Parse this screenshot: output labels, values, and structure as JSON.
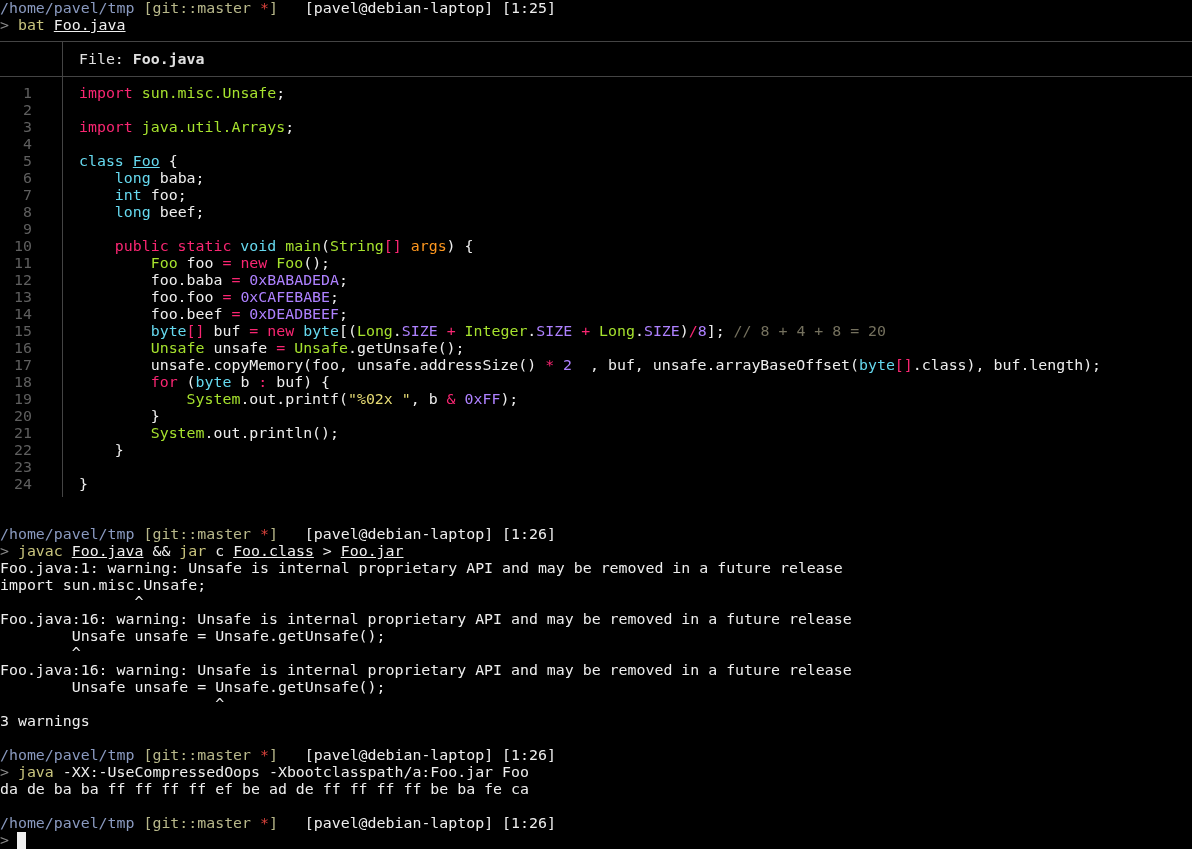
{
  "blocks": [
    {
      "kind": "lines",
      "lines": [
        {
          "kind": "text",
          "tokens": [
            {
              "text": "/home/pavel/tmp",
              "kind": "path"
            },
            {
              "text": " [git::master ",
              "kind": "git"
            },
            {
              "text": "*",
              "kind": "dirty"
            },
            {
              "text": "]",
              "kind": "git"
            },
            {
              "text": "   [pavel@debian-laptop] [1:25]",
              "kind": "plain"
            }
          ]
        },
        {
          "kind": "text",
          "tokens": [
            {
              "text": ">",
              "kind": "prompt"
            },
            {
              "text": " bat ",
              "kind": "command"
            },
            {
              "text": "Foo.java",
              "kind": "file"
            }
          ]
        }
      ]
    },
    {
      "kind": "bat",
      "header": "File: **Foo.java**",
      "lines": [
        {
          "number": "1",
          "tokens": [
            {
              "text": "import",
              "kind": "keyword"
            },
            {
              "text": " sun.misc.Unsafe",
              "kind": "class"
            },
            {
              "text": ";",
              "kind": "plain"
            }
          ]
        },
        {
          "number": "2"
        },
        {
          "number": "3",
          "tokens": [
            {
              "text": "import",
              "kind": "keyword"
            },
            {
              "text": " java.util.Arrays",
              "kind": "class"
            },
            {
              "text": ";",
              "kind": "plain"
            }
          ]
        },
        {
          "number": "4"
        },
        {
          "number": "5",
          "tokens": [
            {
              "text": "class ",
              "kind": "type"
            },
            {
              "text": "Foo",
              "kind": "decl"
            },
            {
              "text": " {",
              "kind": "plain"
            }
          ]
        },
        {
          "number": "6",
          "tokens": [
            {
              "text": "    long",
              "kind": "type"
            },
            {
              "text": " baba;",
              "kind": "plain"
            }
          ]
        },
        {
          "number": "7",
          "tokens": [
            {
              "text": "    int",
              "kind": "type"
            },
            {
              "text": " foo;",
              "kind": "plain"
            }
          ]
        },
        {
          "number": "8",
          "tokens": [
            {
              "text": "    long",
              "kind": "type"
            },
            {
              "text": " beef;",
              "kind": "plain"
            }
          ]
        },
        {
          "number": "9"
        },
        {
          "number": "10",
          "tokens": [
            {
              "text": "    public static",
              "kind": "keyword"
            },
            {
              "text": " void",
              "kind": "type"
            },
            {
              "text": " main",
              "kind": "class"
            },
            {
              "text": "(",
              "kind": "plain"
            },
            {
              "text": "String",
              "kind": "class"
            },
            {
              "text": "[]",
              "kind": "operator"
            },
            {
              "text": " args",
              "kind": "param"
            },
            {
              "text": ") {",
              "kind": "plain"
            }
          ]
        },
        {
          "number": "11",
          "tokens": [
            {
              "text": "        Foo",
              "kind": "class"
            },
            {
              "text": " foo ",
              "kind": "plain"
            },
            {
              "text": "=",
              "kind": "operator"
            },
            {
              "text": " new",
              "kind": "keyword"
            },
            {
              "text": " Foo",
              "kind": "class"
            },
            {
              "text": "();",
              "kind": "plain"
            }
          ]
        },
        {
          "number": "12",
          "tokens": [
            {
              "text": "        foo.baba ",
              "kind": "plain"
            },
            {
              "text": "=",
              "kind": "operator"
            },
            {
              "text": " 0xBABADEDA",
              "kind": "number"
            },
            {
              "text": ";",
              "kind": "plain"
            }
          ]
        },
        {
          "number": "13",
          "tokens": [
            {
              "text": "        foo.foo ",
              "kind": "plain"
            },
            {
              "text": "=",
              "kind": "operator"
            },
            {
              "text": " 0xCAFEBABE",
              "kind": "number"
            },
            {
              "text": ";",
              "kind": "plain"
            }
          ]
        },
        {
          "number": "14",
          "tokens": [
            {
              "text": "        foo.beef ",
              "kind": "plain"
            },
            {
              "text": "=",
              "kind": "operator"
            },
            {
              "text": " 0xDEADBEEF",
              "kind": "number"
            },
            {
              "text": ";",
              "kind": "plain"
            }
          ]
        },
        {
          "number": "15",
          "tokens": [
            {
              "text": "        byte",
              "kind": "type"
            },
            {
              "text": "[]",
              "kind": "operator"
            },
            {
              "text": " buf ",
              "kind": "plain"
            },
            {
              "text": "=",
              "kind": "operator"
            },
            {
              "text": " new",
              "kind": "keyword"
            },
            {
              "text": " byte",
              "kind": "type"
            },
            {
              "text": "[(",
              "kind": "plain"
            },
            {
              "text": "Long",
              "kind": "class"
            },
            {
              "text": ".",
              "kind": "plain"
            },
            {
              "text": "SIZE",
              "kind": "number"
            },
            {
              "text": " +",
              "kind": "operator"
            },
            {
              "text": " Integer",
              "kind": "class"
            },
            {
              "text": ".",
              "kind": "plain"
            },
            {
              "text": "SIZE",
              "kind": "number"
            },
            {
              "text": " +",
              "kind": "operator"
            },
            {
              "text": " Long",
              "kind": "class"
            },
            {
              "text": ".",
              "kind": "plain"
            },
            {
              "text": "SIZE",
              "kind": "number"
            },
            {
              "text": ")",
              "kind": "plain"
            },
            {
              "text": "/",
              "kind": "operator"
            },
            {
              "text": "8",
              "kind": "number"
            },
            {
              "text": "];",
              "kind": "plain"
            },
            {
              "text": " // 8 + 4 + 8 = 20",
              "kind": "comment"
            }
          ]
        },
        {
          "number": "16",
          "tokens": [
            {
              "text": "        Unsafe",
              "kind": "class"
            },
            {
              "text": " unsafe ",
              "kind": "plain"
            },
            {
              "text": "=",
              "kind": "operator"
            },
            {
              "text": " Unsafe",
              "kind": "class"
            },
            {
              "text": ".getUnsafe();",
              "kind": "plain"
            }
          ]
        },
        {
          "number": "17",
          "tokens": [
            {
              "text": "        unsafe.copyMemory(foo, unsafe.addressSize() ",
              "kind": "plain"
            },
            {
              "text": "*",
              "kind": "operator"
            },
            {
              "text": " 2",
              "kind": "number"
            },
            {
              "text": "  , buf, unsafe.arrayBaseOffset(",
              "kind": "plain"
            },
            {
              "text": "byte",
              "kind": "type"
            },
            {
              "text": "[]",
              "kind": "operator"
            },
            {
              "text": ".class), buf.length);",
              "kind": "plain"
            }
          ]
        },
        {
          "number": "18",
          "tokens": [
            {
              "text": "        for",
              "kind": "keyword"
            },
            {
              "text": " (",
              "kind": "plain"
            },
            {
              "text": "byte",
              "kind": "type"
            },
            {
              "text": " b ",
              "kind": "plain"
            },
            {
              "text": ":",
              "kind": "operator"
            },
            {
              "text": " buf) {",
              "kind": "plain"
            }
          ]
        },
        {
          "number": "19",
          "tokens": [
            {
              "text": "            System",
              "kind": "class"
            },
            {
              "text": ".out.printf(",
              "kind": "plain"
            },
            {
              "text": "\"%02x \"",
              "kind": "string"
            },
            {
              "text": ", b ",
              "kind": "plain"
            },
            {
              "text": "&",
              "kind": "operator"
            },
            {
              "text": " 0xFF",
              "kind": "number"
            },
            {
              "text": ");",
              "kind": "plain"
            }
          ]
        },
        {
          "number": "20",
          "tokens": [
            {
              "text": "        }",
              "kind": "plain"
            }
          ]
        },
        {
          "number": "21",
          "tokens": [
            {
              "text": "        System",
              "kind": "class"
            },
            {
              "text": ".out.println();",
              "kind": "plain"
            }
          ]
        },
        {
          "number": "22",
          "tokens": [
            {
              "text": "    }",
              "kind": "plain"
            }
          ]
        },
        {
          "number": "23"
        },
        {
          "number": "24",
          "tokens": [
            {
              "text": "}",
              "kind": "plain"
            }
          ]
        }
      ]
    },
    {
      "kind": "lines",
      "lines": [
        {
          "kind": "blank"
        },
        {
          "kind": "text",
          "tokens": [
            {
              "text": "/home/pavel/tmp",
              "kind": "path"
            },
            {
              "text": " [git::master ",
              "kind": "git"
            },
            {
              "text": "*",
              "kind": "dirty"
            },
            {
              "text": "]",
              "kind": "git"
            },
            {
              "text": "   [pavel@debian-laptop] [1:26]",
              "kind": "plain"
            }
          ]
        },
        {
          "kind": "text",
          "tokens": [
            {
              "text": ">",
              "kind": "prompt"
            },
            {
              "text": " javac ",
              "kind": "command"
            },
            {
              "text": "Foo.java",
              "kind": "file"
            },
            {
              "text": " && ",
              "kind": "plain"
            },
            {
              "text": "jar",
              "kind": "command"
            },
            {
              "text": " c ",
              "kind": "plain"
            },
            {
              "text": "Foo.class",
              "kind": "file"
            },
            {
              "text": " > ",
              "kind": "plain"
            },
            {
              "text": "Foo.jar",
              "kind": "file"
            }
          ]
        },
        {
          "kind": "text",
          "tokens": [
            {
              "text": "Foo.java:1: warning: Unsafe is internal proprietary API and may be removed in a future release",
              "kind": "plain"
            }
          ]
        },
        {
          "kind": "text",
          "tokens": [
            {
              "text": "import sun.misc.Unsafe;",
              "kind": "plain"
            }
          ]
        },
        {
          "kind": "text",
          "tokens": [
            {
              "text": "               ^",
              "kind": "plain"
            }
          ]
        },
        {
          "kind": "text",
          "tokens": [
            {
              "text": "Foo.java:16: warning: Unsafe is internal proprietary API and may be removed in a future release",
              "kind": "plain"
            }
          ]
        },
        {
          "kind": "text",
          "tokens": [
            {
              "text": "        Unsafe unsafe = Unsafe.getUnsafe();",
              "kind": "plain"
            }
          ]
        },
        {
          "kind": "text",
          "tokens": [
            {
              "text": "        ^",
              "kind": "plain"
            }
          ]
        },
        {
          "kind": "text",
          "tokens": [
            {
              "text": "Foo.java:16: warning: Unsafe is internal proprietary API and may be removed in a future release",
              "kind": "plain"
            }
          ]
        },
        {
          "kind": "text",
          "tokens": [
            {
              "text": "        Unsafe unsafe = Unsafe.getUnsafe();",
              "kind": "plain"
            }
          ]
        },
        {
          "kind": "text",
          "tokens": [
            {
              "text": "                        ^",
              "kind": "plain"
            }
          ]
        },
        {
          "kind": "text",
          "tokens": [
            {
              "text": "3 warnings",
              "kind": "plain"
            }
          ]
        },
        {
          "kind": "blank"
        },
        {
          "kind": "text",
          "tokens": [
            {
              "text": "/home/pavel/tmp",
              "kind": "path"
            },
            {
              "text": " [git::master ",
              "kind": "git"
            },
            {
              "text": "*",
              "kind": "dirty"
            },
            {
              "text": "]",
              "kind": "git"
            },
            {
              "text": "   [pavel@debian-laptop] [1:26]",
              "kind": "plain"
            }
          ]
        },
        {
          "kind": "text",
          "tokens": [
            {
              "text": ">",
              "kind": "prompt"
            },
            {
              "text": " java",
              "kind": "command"
            },
            {
              "text": " -XX:-UseCompressedOops -Xbootclasspath/a:Foo.jar Foo",
              "kind": "plain"
            }
          ]
        },
        {
          "kind": "text",
          "tokens": [
            {
              "text": "da de ba ba ff ff ff ff ef be ad de ff ff ff ff be ba fe ca",
              "kind": "plain"
            }
          ]
        },
        {
          "kind": "blank"
        },
        {
          "kind": "text",
          "tokens": [
            {
              "text": "/home/pavel/tmp",
              "kind": "path"
            },
            {
              "text": " [git::master ",
              "kind": "git"
            },
            {
              "text": "*",
              "kind": "dirty"
            },
            {
              "text": "]",
              "kind": "git"
            },
            {
              "text": "   [pavel@debian-laptop] [1:26]",
              "kind": "plain"
            }
          ]
        },
        {
          "kind": "text",
          "cursor": true,
          "tokens": [
            {
              "text": ">",
              "kind": "prompt"
            }
          ]
        }
      ]
    }
  ]
}
